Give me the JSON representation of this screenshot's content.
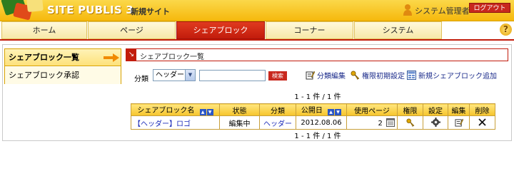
{
  "header": {
    "logo_text": "SITE PUBLIS 3",
    "site_name": "新規サイト",
    "user_name": "システム管理者",
    "logout_label": "ログアウト"
  },
  "nav": {
    "tabs": [
      {
        "label": "ホーム"
      },
      {
        "label": "ページ"
      },
      {
        "label": "シェアブロック"
      },
      {
        "label": "コーナー"
      },
      {
        "label": "システム"
      }
    ],
    "active_index": 2,
    "help_label": "?"
  },
  "sidebar": {
    "items": [
      {
        "label": "シェアブロック一覧"
      },
      {
        "label": "シェアブロック承認"
      }
    ]
  },
  "section": {
    "title": "シェアブロック一覧"
  },
  "filter": {
    "category_label": "分類",
    "category_value": "ヘッダー",
    "keyword_value": "",
    "search_label": "検索"
  },
  "actions": {
    "category_edit": "分類編集",
    "permission_init": "権限初期設定",
    "new_block": "新規シェアブロック追加"
  },
  "pager": {
    "text": "1 - 1 件 / 1 件"
  },
  "table": {
    "headers": {
      "name": "シェアブロック名",
      "status": "状態",
      "category": "分類",
      "published": "公開日",
      "pages_used": "使用ページ",
      "permission": "権限",
      "settings": "設定",
      "edit": "編集",
      "delete": "削除"
    },
    "rows": [
      {
        "name": "【ヘッダー】ロゴ",
        "status": "編集中",
        "category": "ヘッダー",
        "published": "2012.08.06",
        "pages_used": "2"
      }
    ]
  },
  "colors": {
    "header_yellow": "#f6b80c",
    "active_tab_red": "#c21c0c",
    "link_blue": "#1a2ab8"
  }
}
